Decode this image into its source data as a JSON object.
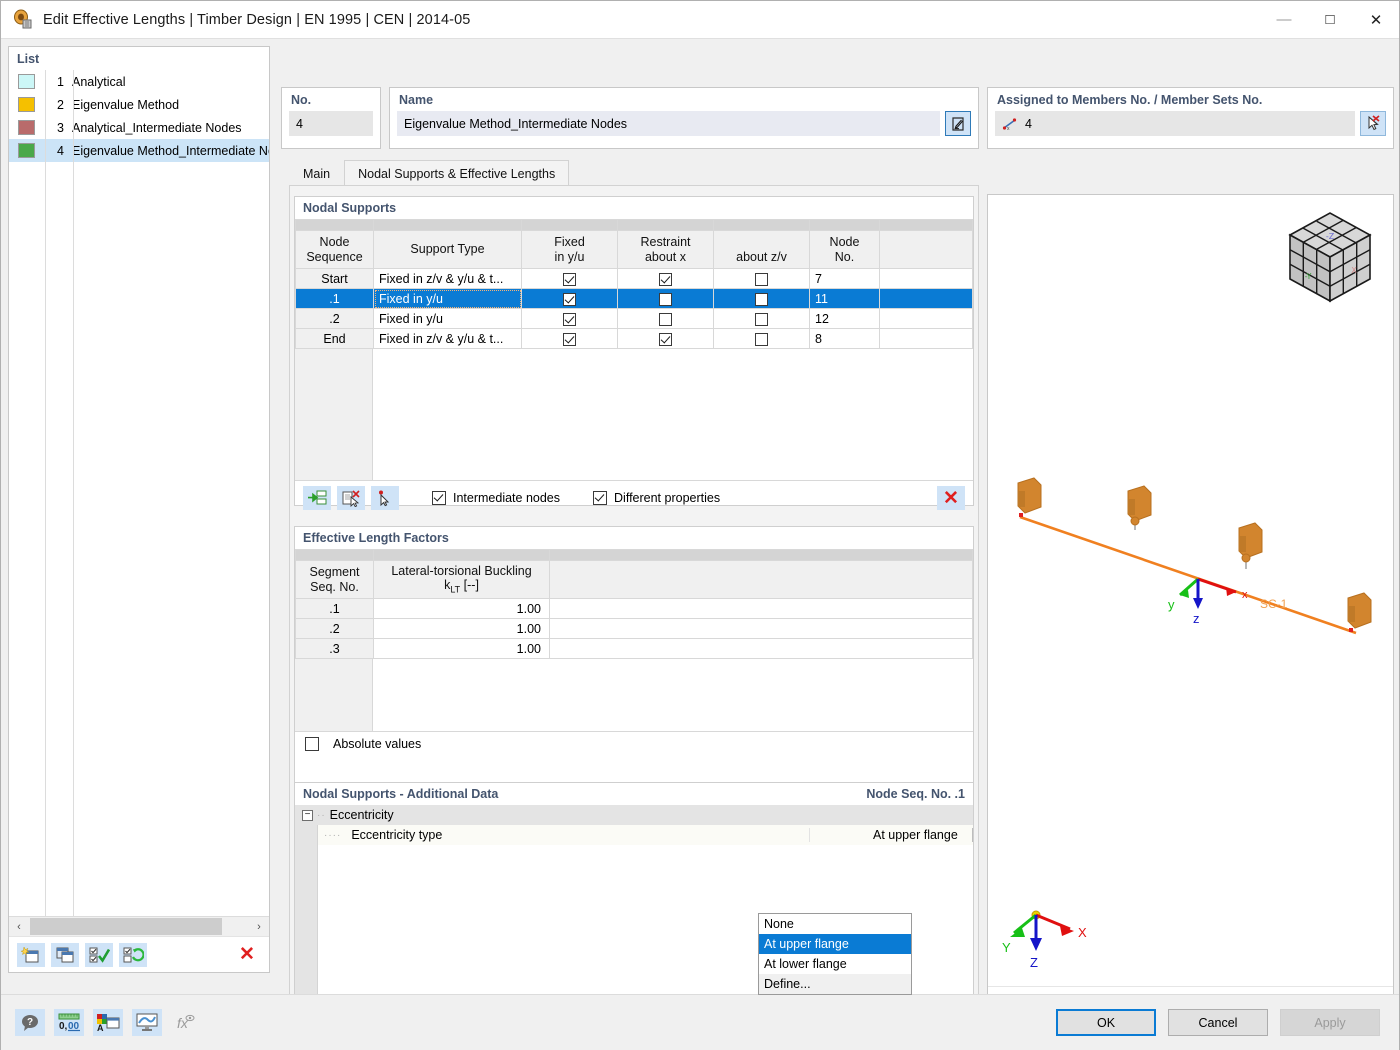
{
  "window": {
    "title": "Edit Effective Lengths | Timber Design | EN 1995 | CEN | 2014-05",
    "icon": "app-icon",
    "minimize": "—",
    "maximize": "□",
    "close": "✕"
  },
  "list_panel": {
    "caption": "List",
    "items": [
      {
        "num": "1",
        "label": "Analytical",
        "color": "#ccf7f7"
      },
      {
        "num": "2",
        "label": "Eigenvalue Method",
        "color": "#f5c000"
      },
      {
        "num": "3",
        "label": "Analytical_Intermediate Nodes",
        "color": "#b96b6b"
      },
      {
        "num": "4",
        "label": "Eigenvalue Method_Intermediate No",
        "color": "#4aa84a"
      }
    ],
    "selected_index": 3,
    "scroll_left_arrow": "‹",
    "scroll_right_arrow": "›",
    "toolbar": [
      {
        "name": "new-item-button",
        "glyph": "new"
      },
      {
        "name": "copy-item-button",
        "glyph": "copy"
      },
      {
        "name": "select-all-button",
        "glyph": "checkall"
      },
      {
        "name": "invert-selection-button",
        "glyph": "invert"
      },
      {
        "name": "delete-item-button",
        "glyph": "✕"
      }
    ]
  },
  "no_field": {
    "caption": "No.",
    "value": "4"
  },
  "name_field": {
    "caption": "Name",
    "value": "Eigenvalue Method_Intermediate Nodes",
    "edit_button": "edit-name-icon"
  },
  "assigned_field": {
    "caption": "Assigned to Members No. / Member Sets No.",
    "value": "4",
    "member_icon": "member-icon",
    "pick_button": "pick-deselect-icon"
  },
  "tabs": [
    {
      "label": "Main",
      "active": false
    },
    {
      "label": "Nodal Supports & Effective Lengths",
      "active": true
    }
  ],
  "nodal_supports": {
    "title": "Nodal Supports",
    "headers": {
      "node_sequence": "Node\nSequence",
      "support_type": "Support Type",
      "fixed": "Fixed",
      "fixed_sub": "in y/u",
      "restraint": "Restraint",
      "restraint_x": "about x",
      "restraint_zv": "about z/v",
      "node_no": "Node\nNo."
    },
    "rows": [
      {
        "seq": "Start",
        "type": "Fixed in z/v & y/u & t...",
        "fixed_yu": true,
        "about_x": true,
        "about_zv": false,
        "node_no": "7",
        "selected": false
      },
      {
        "seq": ".1",
        "type": "Fixed in y/u",
        "fixed_yu": true,
        "about_x": false,
        "about_zv": false,
        "node_no": "11",
        "selected": true
      },
      {
        "seq": ".2",
        "type": "Fixed in y/u",
        "fixed_yu": true,
        "about_x": false,
        "about_zv": false,
        "node_no": "12",
        "selected": false
      },
      {
        "seq": "End",
        "type": "Fixed in z/v & y/u & t...",
        "fixed_yu": true,
        "about_x": true,
        "about_zv": false,
        "node_no": "8",
        "selected": false
      }
    ],
    "toolbar": [
      {
        "name": "insert-row-button",
        "glyph": "insert"
      },
      {
        "name": "edit-row-button",
        "glyph": "editrow"
      },
      {
        "name": "pick-node-button",
        "glyph": "picknode"
      }
    ],
    "intermediate_nodes_label": "Intermediate nodes",
    "intermediate_nodes_checked": true,
    "different_properties_label": "Different properties",
    "different_properties_checked": true,
    "delete_button": "✕"
  },
  "effective_length_factors": {
    "title": "Effective Length Factors",
    "headers": {
      "segment": "Segment\nSeq. No.",
      "ltb_line1": "Lateral-torsional Buckling",
      "ltb_line2_pre": "k",
      "ltb_line2_sub": "LT",
      "ltb_line2_post": " [--]"
    },
    "rows": [
      {
        "seq": ".1",
        "klt": "1.00"
      },
      {
        "seq": ".2",
        "klt": "1.00"
      },
      {
        "seq": ".3",
        "klt": "1.00"
      }
    ],
    "absolute_values_label": "Absolute values",
    "absolute_values_checked": false
  },
  "additional_data": {
    "title": "Nodal Supports - Additional Data",
    "node_seq_label": "Node Seq. No. .1",
    "group_label": "Eccentricity",
    "group_expander": "−",
    "item_label": "Eccentricity type",
    "item_value": "At upper flange",
    "dropdown_options": [
      {
        "label": "None",
        "selected": false,
        "muted": false
      },
      {
        "label": "At upper flange",
        "selected": true,
        "muted": false
      },
      {
        "label": "At lower flange",
        "selected": false,
        "muted": false
      },
      {
        "label": "Define...",
        "selected": false,
        "muted": true
      }
    ]
  },
  "viewport": {
    "member_label": "SC-1",
    "axis_x": "x",
    "axis_y": "y",
    "axis_z": "z",
    "global_x": "X",
    "global_y": "Y",
    "global_z": "Z",
    "nav_cube": "navigation-cube",
    "member_color": "#f08020",
    "support_color": "#d2852e",
    "toolbar": [
      {
        "name": "render-mode-button",
        "glyph": "render",
        "framed": true
      },
      {
        "name": "info-button",
        "glyph": "info",
        "disabled": true
      },
      {
        "name": "numbering-button",
        "glyph": "numbers"
      },
      {
        "name": "measure-button",
        "glyph": "measure",
        "framed": true
      },
      {
        "name": "view-x-button",
        "glyph": "X"
      },
      {
        "name": "view-ny-button",
        "glyph": "-Y"
      },
      {
        "name": "view-z-button",
        "glyph": "Z"
      },
      {
        "name": "view-nz-button",
        "glyph": "-Z"
      },
      {
        "name": "shading-button",
        "glyph": "shade"
      },
      {
        "name": "wireframe-button",
        "glyph": "wire"
      },
      {
        "name": "print-button",
        "glyph": "print"
      },
      {
        "name": "print-dropdown-button",
        "glyph": "▾"
      },
      {
        "name": "zoom-reset-button",
        "glyph": "zoomreset"
      }
    ]
  },
  "bottom_bar": {
    "left_buttons": [
      {
        "name": "help-button",
        "glyph": "help"
      },
      {
        "name": "units-button",
        "glyph": "units"
      },
      {
        "name": "display-properties-button",
        "glyph": "display"
      },
      {
        "name": "graphic-button",
        "glyph": "graphic"
      },
      {
        "name": "formula-button",
        "glyph": "formula",
        "disabled": true
      }
    ],
    "ok": "OK",
    "cancel": "Cancel",
    "apply": "Apply"
  }
}
